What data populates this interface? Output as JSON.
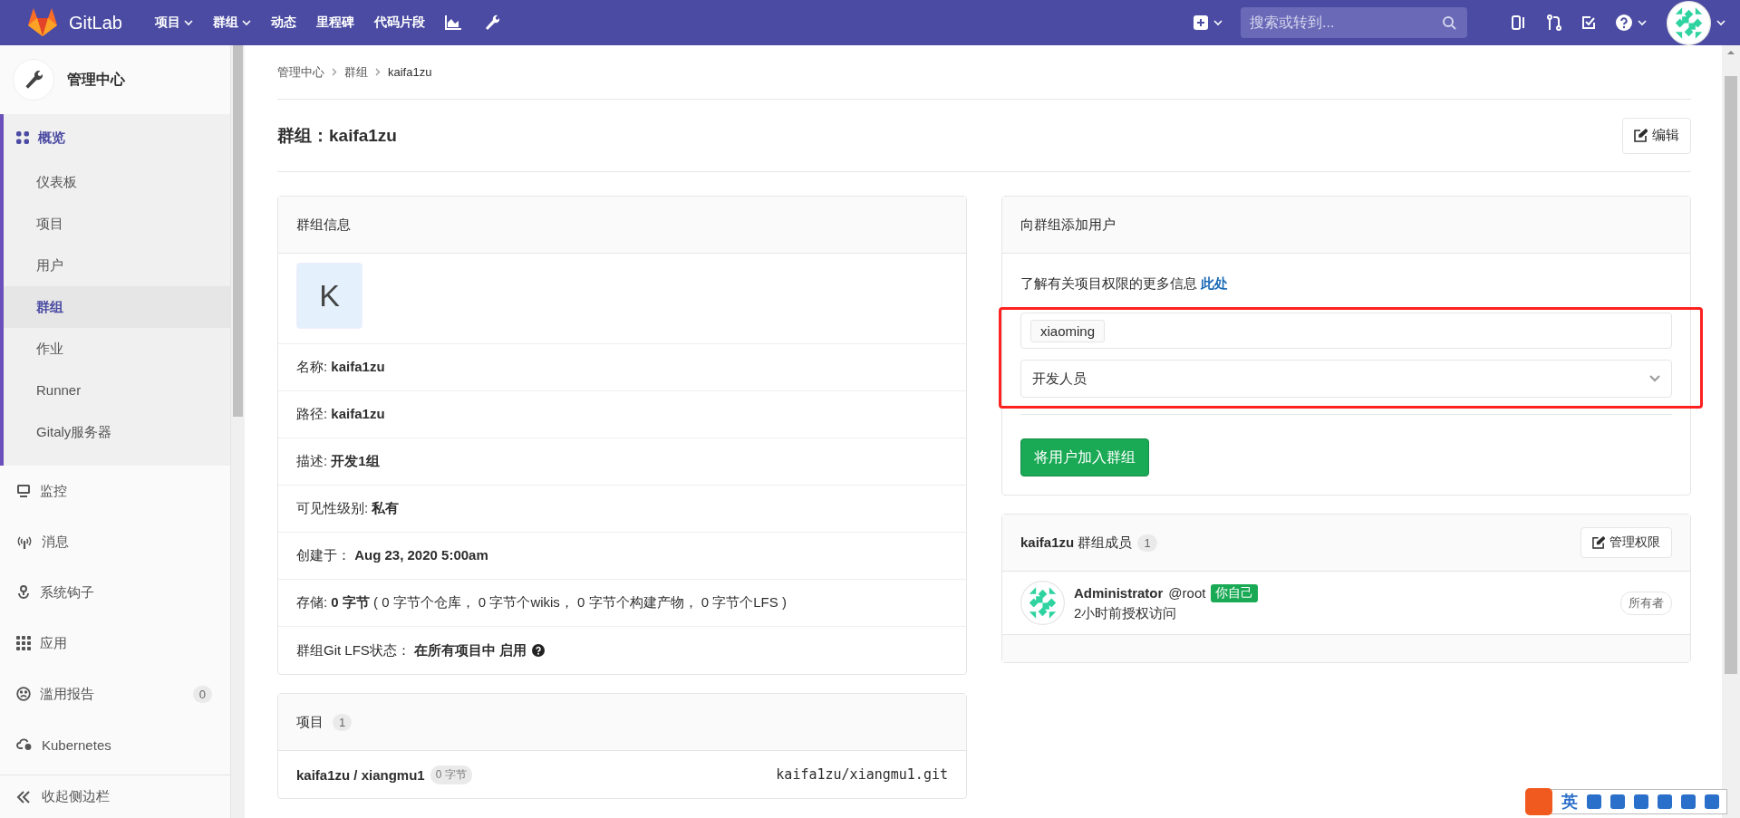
{
  "navbar": {
    "logo_text": "GitLab",
    "items": [
      {
        "label": "项目",
        "kind": "dropdown"
      },
      {
        "label": "群组",
        "kind": "dropdown"
      },
      {
        "label": "动态",
        "kind": "link"
      },
      {
        "label": "里程碑",
        "kind": "link"
      },
      {
        "label": "代码片段",
        "kind": "link"
      }
    ],
    "search": {
      "placeholder": "搜索或转到..."
    }
  },
  "sidebar": {
    "title": "管理中心",
    "items": [
      {
        "label": "概览",
        "kind": "overview",
        "selected": true,
        "children": [
          {
            "label": "仪表板",
            "selected": false
          },
          {
            "label": "项目",
            "selected": false
          },
          {
            "label": "用户",
            "selected": false
          },
          {
            "label": "群组",
            "selected": true
          },
          {
            "label": "作业",
            "selected": false
          },
          {
            "label": "Runner",
            "selected": false
          },
          {
            "label": "Gitaly服务器",
            "selected": false
          }
        ]
      },
      {
        "label": "监控",
        "kind": "monitor",
        "selected": false
      },
      {
        "label": "消息",
        "kind": "broadcast",
        "selected": false
      },
      {
        "label": "系统钩子",
        "kind": "hook",
        "selected": false
      },
      {
        "label": "应用",
        "kind": "apps",
        "selected": false
      },
      {
        "label": "滥用报告",
        "kind": "report",
        "selected": false,
        "badge": "0"
      },
      {
        "label": "Kubernetes",
        "kind": "cloud",
        "selected": false
      }
    ],
    "collapse_label": "收起侧边栏"
  },
  "breadcrumb": [
    "管理中心",
    "群组",
    "kaifa1zu"
  ],
  "page_title": "群组：kaifa1zu",
  "edit_button": "编辑",
  "group_info": {
    "title": "群组信息",
    "avatar_letter": "K",
    "rows": [
      {
        "text": "名称: **kaifa1zu**",
        "kind": "text"
      },
      {
        "text": "路径: **kaifa1zu**",
        "kind": "text"
      },
      {
        "text": "描述: **开发1组**",
        "kind": "text"
      },
      {
        "text": "可见性级别: **私有**",
        "kind": "text"
      },
      {
        "text": "创建于：  **Aug 23, 2020 5:00am**",
        "kind": "text"
      },
      {
        "text": "存储: **0 字节** ( 0 字节个仓库， 0 字节个wikis， 0 字节个构建产物， 0 字节个LFS )",
        "kind": "text"
      },
      {
        "text": "群组Git LFS状态：  **在所有项目中 启用**",
        "kind": "help"
      }
    ]
  },
  "projects": {
    "title": "项目",
    "count": "1",
    "items": [
      {
        "name": "kaifa1zu / xiangmu1",
        "size": "0 字节",
        "path": "kaifa1zu/xiangmu1.git"
      }
    ]
  },
  "add_user": {
    "title": "向群组添加用户",
    "info": "了解有关项目权限的更多信息",
    "info_link": "此处",
    "user_token": "xiaoming",
    "role": "开发人员",
    "submit": "将用户加入群组"
  },
  "members": {
    "group": "kaifa1zu",
    "title": "群组成员",
    "count": "1",
    "manage_button": "管理权限",
    "items": [
      {
        "name": "Administrator",
        "username": "@root",
        "badge": "你自己",
        "access": "2小时前授权访问",
        "role": "所有者"
      }
    ]
  },
  "ime_toolbar": {
    "label": "英"
  }
}
